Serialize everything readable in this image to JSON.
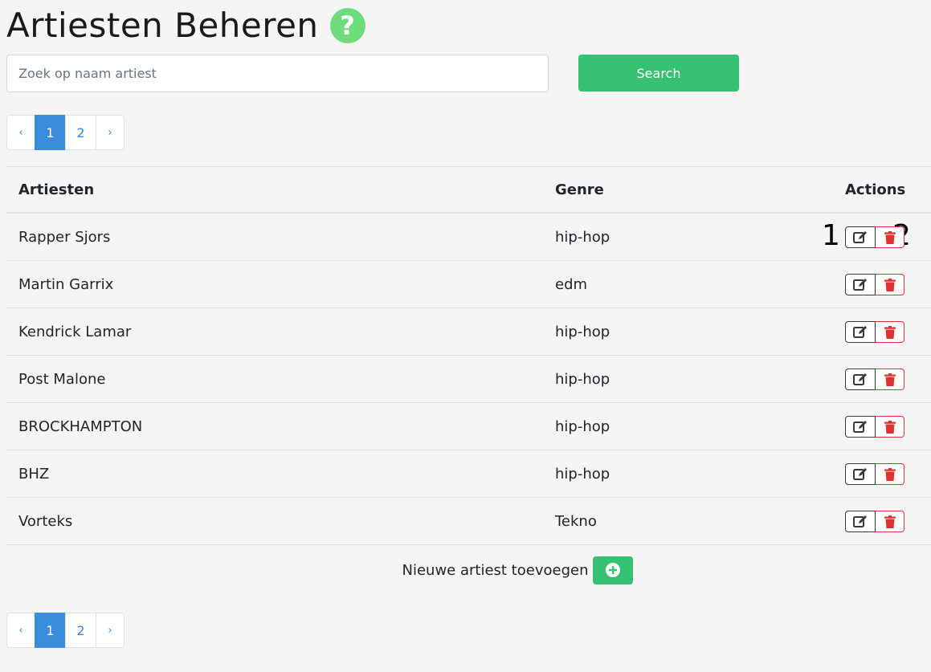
{
  "page": {
    "title": "Artiesten Beheren",
    "help_icon": "question-circle-icon"
  },
  "search": {
    "placeholder": "Zoek op naam artiest",
    "value": "",
    "button_label": "Search"
  },
  "pagination": {
    "prev": "‹",
    "pages": [
      "1",
      "2"
    ],
    "active_page": "1",
    "next": "›"
  },
  "table": {
    "headers": {
      "name": "Artiesten",
      "genre": "Genre",
      "actions": "Actions"
    },
    "rows": [
      {
        "name": "Rapper Sjors",
        "genre": "hip-hop"
      },
      {
        "name": "Martin Garrix",
        "genre": "edm"
      },
      {
        "name": "Kendrick Lamar",
        "genre": "hip-hop"
      },
      {
        "name": "Post Malone",
        "genre": "hip-hop"
      },
      {
        "name": "BROCKHAMPTON",
        "genre": "hip-hop"
      },
      {
        "name": "BHZ",
        "genre": "hip-hop"
      },
      {
        "name": "Vorteks",
        "genre": "Tekno"
      }
    ],
    "annotations": {
      "edit": "1",
      "delete": "2"
    }
  },
  "add_artist": {
    "label": "Nieuwe artiest toevoegen",
    "icon": "plus-circle-icon"
  },
  "colors": {
    "accent_green": "#35c172",
    "help_green": "#6fdc7b",
    "active_blue": "#3a8ddb",
    "delete_red": "#e03131"
  }
}
